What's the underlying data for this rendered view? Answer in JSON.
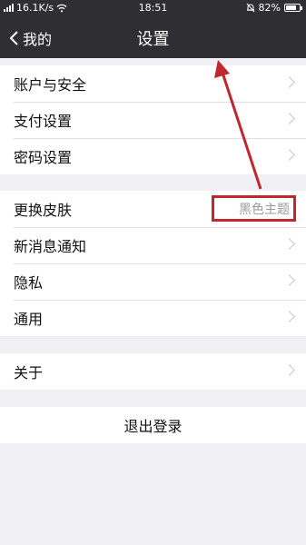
{
  "status_bar": {
    "network_speed": "16.1K/s",
    "time": "18:51",
    "battery": "82%",
    "battery_level": 0.82,
    "icons": [
      "signal-icon",
      "wifi-icon",
      "alarm-icon",
      "battery-icon"
    ]
  },
  "nav": {
    "back_label": "我的",
    "title": "设置"
  },
  "groups": [
    {
      "items": [
        {
          "label": "账户与安全"
        },
        {
          "label": "支付设置"
        },
        {
          "label": "密码设置"
        }
      ]
    },
    {
      "items": [
        {
          "label": "更换皮肤",
          "value": "黑色主题"
        },
        {
          "label": "新消息通知"
        },
        {
          "label": "隐私"
        },
        {
          "label": "通用"
        }
      ]
    },
    {
      "items": [
        {
          "label": "关于"
        }
      ]
    }
  ],
  "logout_label": "退出登录",
  "colors": {
    "nav_background": "#2f2f33",
    "page_background": "#efeff4",
    "annotation": "#c0282d"
  }
}
